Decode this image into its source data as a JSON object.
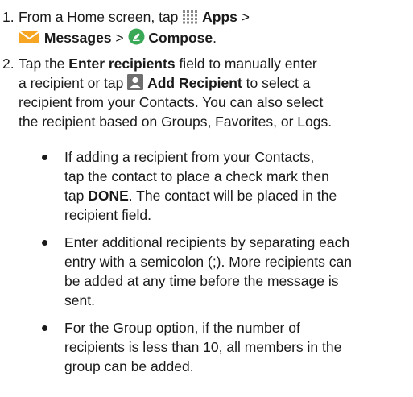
{
  "step1": {
    "number": "1.",
    "prefix": "From a Home screen, tap",
    "apps_label": "Apps",
    "sep1": ">",
    "messages_label": "Messages",
    "sep2": ">",
    "compose_label": "Compose",
    "end": ".",
    "icons": [
      "apps-grid-icon",
      "messages-envelope-icon",
      "compose-icon"
    ]
  },
  "step2": {
    "number": "2.",
    "tap": "Tap the",
    "enter_recipients": "Enter recipients",
    "line1_rest": "field to manually enter",
    "line2_a": "a recipient or tap",
    "add_recipient": "Add Recipient",
    "line2_b": "to select a",
    "line3": "recipient from your Contacts. You can also select",
    "line4": "the recipient based on Groups, Favorites, or Logs.",
    "icon": "add-recipient-icon"
  },
  "bullets": [
    {
      "lines": [
        "If adding a recipient from your Contacts,",
        "tap the contact to place a check mark then"
      ],
      "line3_a": "tap",
      "done": "DONE",
      "line3_b": ". The contact will be placed in the",
      "line4": "recipient field."
    },
    {
      "lines": [
        "Enter additional recipients by separating each",
        "entry with a semicolon (;). More recipients can",
        "be added at any time before the message is",
        "sent."
      ]
    },
    {
      "lines": [
        "For the Group option, if the number of",
        "recipients is less than 10, all members in the",
        "group can be added."
      ]
    }
  ]
}
